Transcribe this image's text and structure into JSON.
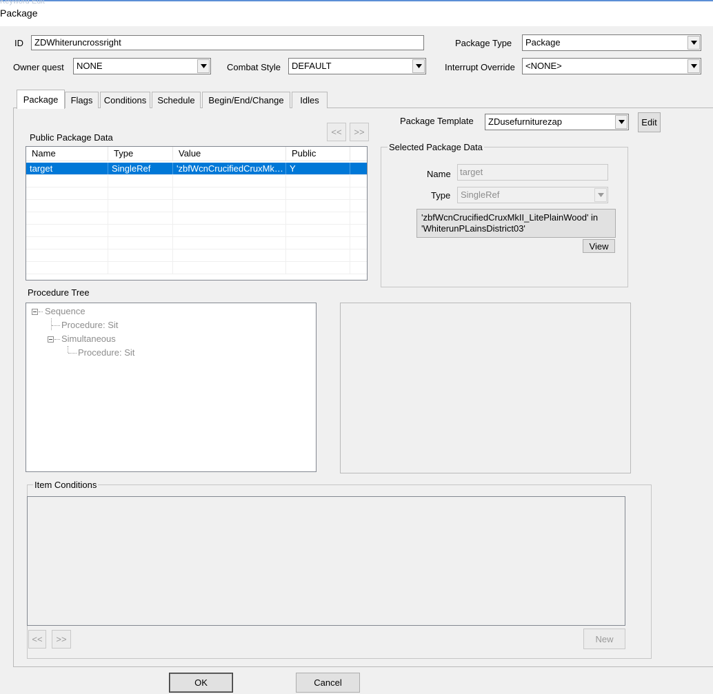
{
  "window": {
    "ghost_title": "Keyword Edit",
    "title": "Package"
  },
  "form": {
    "id_label": "ID",
    "id_value": "ZDWhiteruncrossright",
    "package_type_label": "Package Type",
    "package_type_value": "Package",
    "owner_quest_label": "Owner quest",
    "owner_quest_value": "NONE",
    "combat_style_label": "Combat Style",
    "combat_style_value": "DEFAULT",
    "interrupt_override_label": "Interrupt Override",
    "interrupt_override_value": "<NONE>"
  },
  "tabs": [
    "Package",
    "Flags",
    "Conditions",
    "Schedule",
    "Begin/End/Change",
    "Idles"
  ],
  "package_template": {
    "label": "Package Template",
    "value": "ZDusefurniturezap",
    "edit_label": "Edit"
  },
  "public_data": {
    "title": "Public Package Data",
    "prev_label": "<<",
    "next_label": ">>",
    "columns": [
      "Name",
      "Type",
      "Value",
      "Public"
    ],
    "rows": [
      {
        "name": "target",
        "type": "SingleRef",
        "value": "'zbfWcnCrucifiedCruxMkII_LitePlainWood' in 'WhiterunPLainsDistrict03'",
        "public": "Y"
      }
    ]
  },
  "selected_data": {
    "title": "Selected Package Data",
    "name_label": "Name",
    "name_value": "target",
    "type_label": "Type",
    "type_value": "SingleRef",
    "ref_line1": "'zbfWcnCrucifiedCruxMkII_LitePlainWood' in",
    "ref_line2": "'WhiterunPLainsDistrict03'",
    "view_label": "View"
  },
  "procedure_tree": {
    "title": "Procedure Tree",
    "nodes": [
      "Sequence",
      "Procedure: Sit",
      "Simultaneous",
      "Procedure: Sit"
    ]
  },
  "item_conditions": {
    "title": "Item Conditions",
    "prev_label": "<<",
    "next_label": ">>",
    "new_label": "New"
  },
  "footer": {
    "ok_label": "OK",
    "cancel_label": "Cancel"
  }
}
